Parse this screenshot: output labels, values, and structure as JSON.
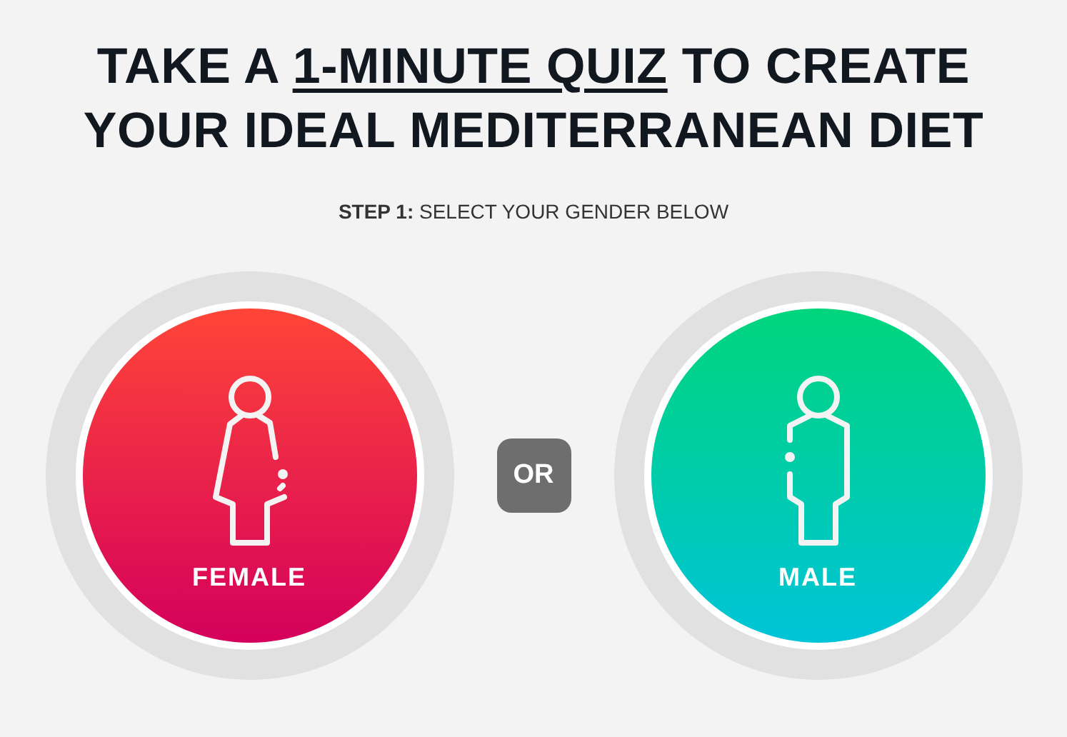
{
  "headline": {
    "before": "TAKE A",
    "link": "1-MINUTE QUIZ",
    "after": "TO CREATE YOUR IDEAL MEDITERRANEAN DIET"
  },
  "step": {
    "label": "STEP 1:",
    "text": "SELECT YOUR GENDER BELOW"
  },
  "options": [
    {
      "kind": "female",
      "label": "FEMALE"
    },
    {
      "kind": "male",
      "label": "MALE"
    }
  ],
  "separator": "OR"
}
